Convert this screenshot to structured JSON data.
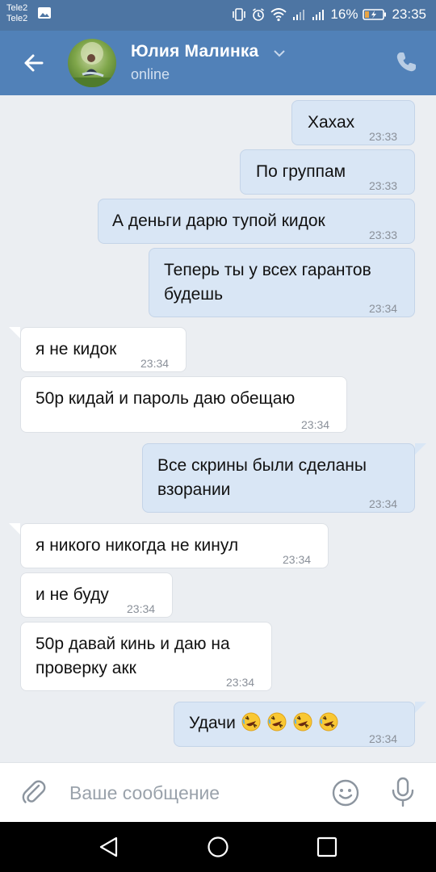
{
  "status_bar": {
    "carrier1": "Tele2",
    "carrier2": "Tele2",
    "battery": "16%",
    "time": "23:35"
  },
  "header": {
    "contact_name": "Юлия Малинка",
    "status": "online",
    "icons": [
      "back-arrow-icon",
      "chevron-down-icon",
      "phone-icon"
    ]
  },
  "messages": [
    {
      "dir": "out",
      "text": "Хахах",
      "time": "23:33"
    },
    {
      "dir": "out",
      "text": "По группам",
      "time": "23:33"
    },
    {
      "dir": "out",
      "text": "А деньги дарю тупой кидок",
      "time": "23:33"
    },
    {
      "dir": "out",
      "text_line1": "Теперь ты у всех гарантов",
      "text_line2": "будешь",
      "time": "23:34"
    },
    {
      "dir": "in",
      "text": "я не кидок",
      "time": "23:34"
    },
    {
      "dir": "in",
      "text": "50р кидай и пароль даю обещаю",
      "time": "23:34"
    },
    {
      "dir": "out",
      "text_line1": "Все скрины были сделаны",
      "text_line2": "взорании",
      "time": "23:34"
    },
    {
      "dir": "in",
      "text": "я никого никогда не кинул",
      "time": "23:34"
    },
    {
      "dir": "in",
      "text": "и не буду",
      "time": "23:34"
    },
    {
      "dir": "in",
      "text_line1": "50р давай кинь и даю на",
      "text_line2": "проверку акк",
      "time": "23:34"
    },
    {
      "dir": "out",
      "text": "Удачи",
      "emoji": "rolling-on-floor-laughing x4",
      "time": "23:34"
    }
  ],
  "input_bar": {
    "placeholder": "Ваше сообщение",
    "icons": [
      "paperclip-icon",
      "smiley-icon",
      "microphone-icon"
    ]
  },
  "nav_bar": {
    "icons": [
      "nav-back-icon",
      "nav-home-icon",
      "nav-recent-icon"
    ]
  },
  "colors": {
    "header": "#5181b8",
    "status_bar": "#4d75a3",
    "background": "#ebeef2",
    "outgoing_bubble": "#d9e6f5",
    "incoming_bubble": "#ffffff"
  }
}
